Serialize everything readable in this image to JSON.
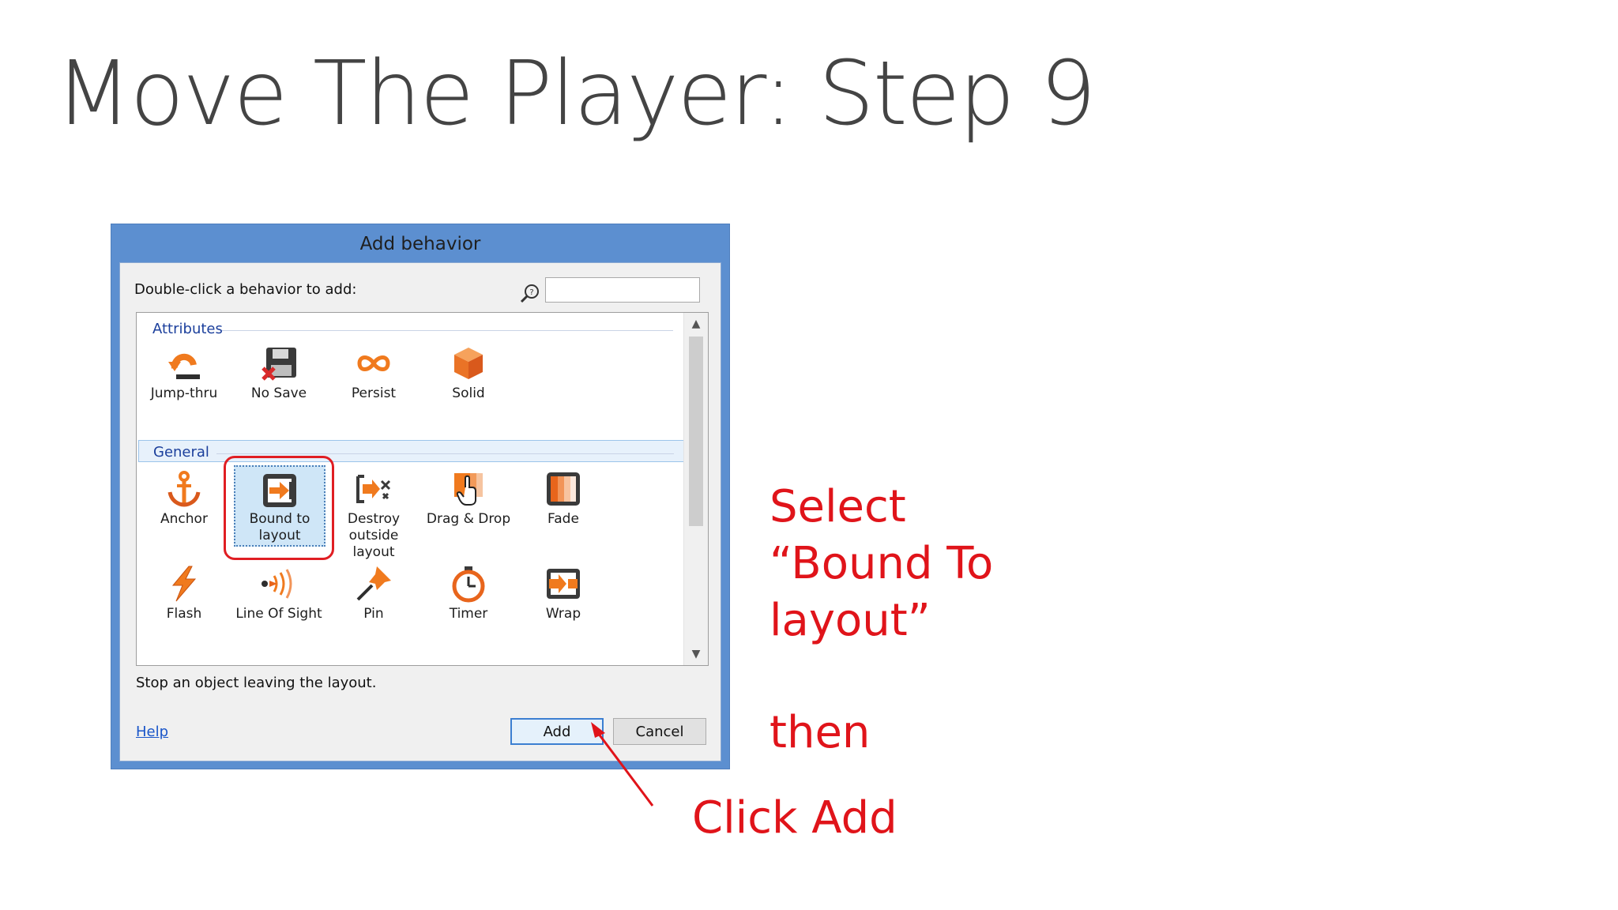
{
  "slide": {
    "title": "Move The Player: Step 9"
  },
  "dialog": {
    "title": "Add behavior",
    "prompt": "Double-click a behavior to add:",
    "search": {
      "value": "",
      "placeholder": ""
    },
    "sections": [
      {
        "name": "Attributes",
        "items": [
          {
            "label": "Jump-thru",
            "icon": "jump-thru-icon"
          },
          {
            "label": "No Save",
            "icon": "floppy-disk-x-icon"
          },
          {
            "label": "Persist",
            "icon": "infinity-icon"
          },
          {
            "label": "Solid",
            "icon": "cube-icon"
          }
        ]
      },
      {
        "name": "General",
        "items": [
          {
            "label": "Anchor",
            "icon": "anchor-icon"
          },
          {
            "label": "Bound to layout",
            "icon": "bound-arrow-icon",
            "selected": true
          },
          {
            "label": "Destroy outside layout",
            "icon": "destroy-outside-icon"
          },
          {
            "label": "Drag & Drop",
            "icon": "drag-hand-icon"
          },
          {
            "label": "Fade",
            "icon": "fade-icon"
          },
          {
            "label": "Flash",
            "icon": "lightning-icon"
          },
          {
            "label": "Line Of Sight",
            "icon": "line-of-sight-icon"
          },
          {
            "label": "Pin",
            "icon": "pushpin-icon"
          },
          {
            "label": "Timer",
            "icon": "stopwatch-icon"
          },
          {
            "label": "Wrap",
            "icon": "wrap-icon"
          }
        ]
      }
    ],
    "description": "Stop an object leaving the layout.",
    "help_label": "Help",
    "add_label": "Add",
    "cancel_label": "Cancel"
  },
  "annotations": {
    "select_line1": "Select",
    "select_line2": "“Bound To",
    "select_line3": "layout”",
    "then": "then",
    "click_add": "Click Add"
  },
  "colors": {
    "dialog_frame": "#5c8fd0",
    "annotation": "#e0141a",
    "section_text": "#1b3f9c",
    "icon_orange": "#f07a1e"
  }
}
